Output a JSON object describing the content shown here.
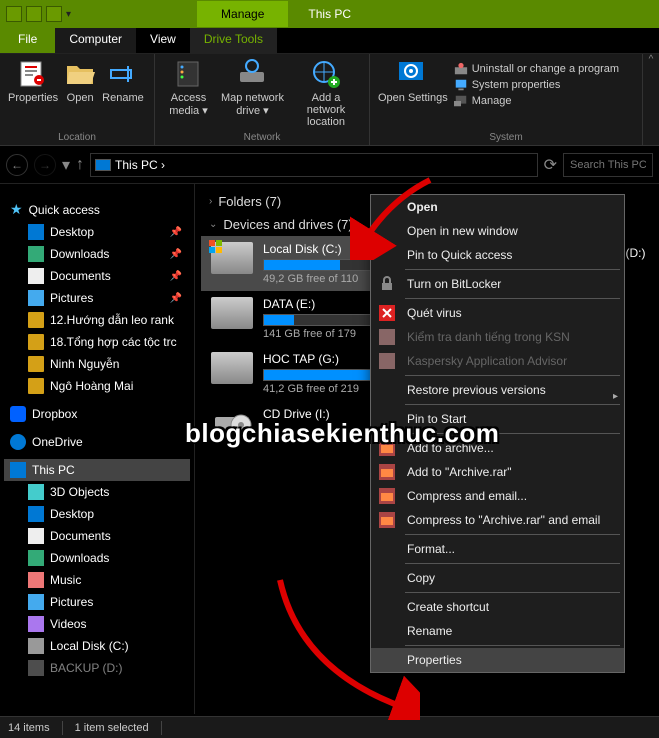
{
  "titlebar": {
    "manage": "Manage",
    "title": "This PC"
  },
  "menutabs": {
    "file": "File",
    "computer": "Computer",
    "view": "View",
    "drivetools": "Drive Tools"
  },
  "ribbon": {
    "location": {
      "properties": "Properties",
      "open": "Open",
      "rename": "Rename",
      "label": "Location"
    },
    "network": {
      "accessmedia": "Access media ▾",
      "mapdrive": "Map network drive ▾",
      "addloc": "Add a network location",
      "label": "Network"
    },
    "system": {
      "opensettings": "Open Settings",
      "uninstall": "Uninstall or change a program",
      "sysprops": "System properties",
      "manage": "Manage",
      "label": "System"
    }
  },
  "addrbar": {
    "path": "This PC  ›",
    "search_ph": "Search This PC"
  },
  "sidebar": {
    "quickaccess": "Quick access",
    "desktop": "Desktop",
    "downloads": "Downloads",
    "documents": "Documents",
    "pictures": "Pictures",
    "f1": "12.Hướng dẫn leo rank",
    "f2": "18.Tổng hợp các tộc trc",
    "f3": "Ninh Nguyễn",
    "f4": "Ngô Hoàng Mai",
    "dropbox": "Dropbox",
    "onedrive": "OneDrive",
    "thispc": "This PC",
    "s3d": "3D Objects",
    "sdesk": "Desktop",
    "sdocs": "Documents",
    "sdown": "Downloads",
    "smusic": "Music",
    "spics": "Pictures",
    "svids": "Videos",
    "sldc": "Local Disk (C:)",
    "sbak": "BACKUP (D:)"
  },
  "content": {
    "folders": "Folders (7)",
    "devices": "Devices and drives (7)",
    "drives": [
      {
        "name": "Local Disk (C:)",
        "free": "49,2 GB free of 110",
        "pct": 55
      },
      {
        "name": "DATA (E:)",
        "free": "141 GB free of 179",
        "pct": 22
      },
      {
        "name": "HOC TAP (G:)",
        "free": "41,2 GB free of 219",
        "pct": 81
      },
      {
        "name": "CD Drive (I:)",
        "free": "",
        "pct": 0
      }
    ],
    "backup": "BACKUP (D:)"
  },
  "ctx": {
    "open": "Open",
    "opennew": "Open in new window",
    "pinqa": "Pin to Quick access",
    "bitlocker": "Turn on BitLocker",
    "virus": "Quét virus",
    "ksn": "Kiểm tra danh tiếng trong KSN",
    "kaa": "Kaspersky Application Advisor",
    "restore": "Restore previous versions",
    "pinstart": "Pin to Start",
    "addarch": "Add to archive...",
    "addrar": "Add to \"Archive.rar\"",
    "compemail": "Compress and email...",
    "comprar": "Compress to \"Archive.rar\" and email",
    "format": "Format...",
    "copy": "Copy",
    "shortcut": "Create shortcut",
    "rename": "Rename",
    "properties": "Properties"
  },
  "statusbar": {
    "items": "14 items",
    "selected": "1 item selected"
  },
  "watermark": "blogchiasekienthuc.com"
}
